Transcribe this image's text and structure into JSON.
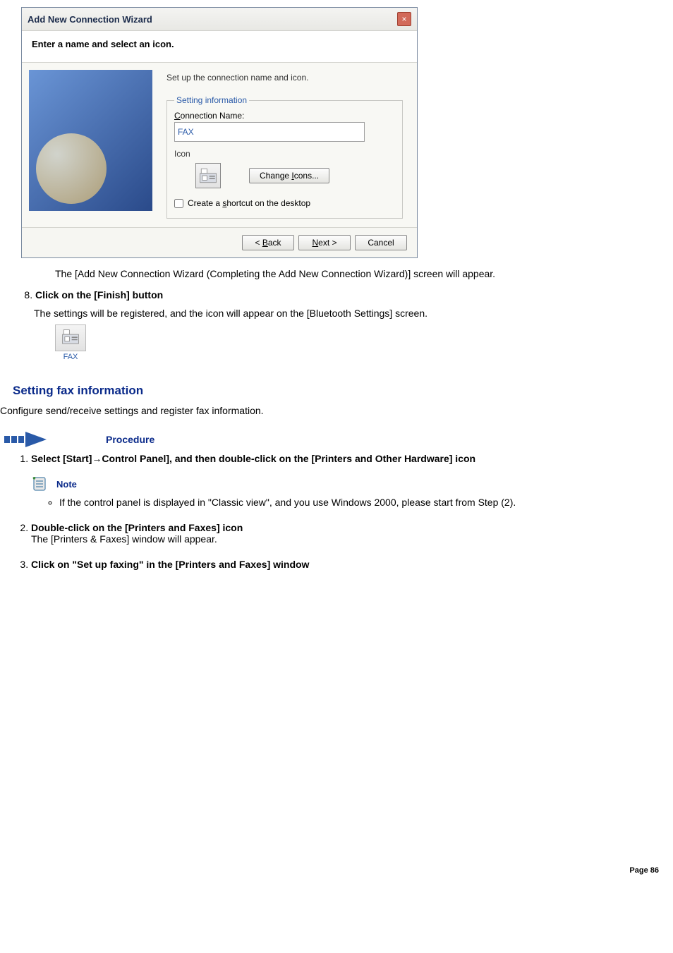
{
  "wizard": {
    "title": "Add New Connection Wizard",
    "header": "Enter a name and select an icon.",
    "setup_label": "Set up the connection name and icon.",
    "fieldset_legend": "Setting information",
    "conn_label": "Connection Name:",
    "conn_value": "FAX",
    "icon_label": "Icon",
    "change_btn": "Change Icons...",
    "shortcut_label": "Create a shortcut on the desktop",
    "back_btn": "< Back",
    "next_btn": "Next >",
    "cancel_btn": "Cancel"
  },
  "doc": {
    "after_wizard": "The [Add New Connection Wizard (Completing the Add New Connection Wizard)] screen will appear.",
    "step8": "Click on the [Finish] button",
    "after_step8": "The settings will be registered, and the icon will appear on the [Bluetooth Settings] screen.",
    "fax_caption": "FAX",
    "section_heading": "Setting fax information",
    "section_body": "Configure send/receive settings and register fax information.",
    "procedure_label": "Procedure",
    "step1": "Select [Start]→Control Panel], and then double-click on the [Printers and Other Hardware] icon",
    "note_label": "Note",
    "note_item": "If the control panel is displayed in \"Classic view\", and you use Windows 2000, please start from Step (2).",
    "step2_bold": "Double-click on the [Printers and Faxes] icon",
    "step2_sub": "The [Printers & Faxes] window will appear.",
    "step3": "Click on \"Set up faxing\" in the [Printers and Faxes] window",
    "page_number": "Page 86"
  }
}
